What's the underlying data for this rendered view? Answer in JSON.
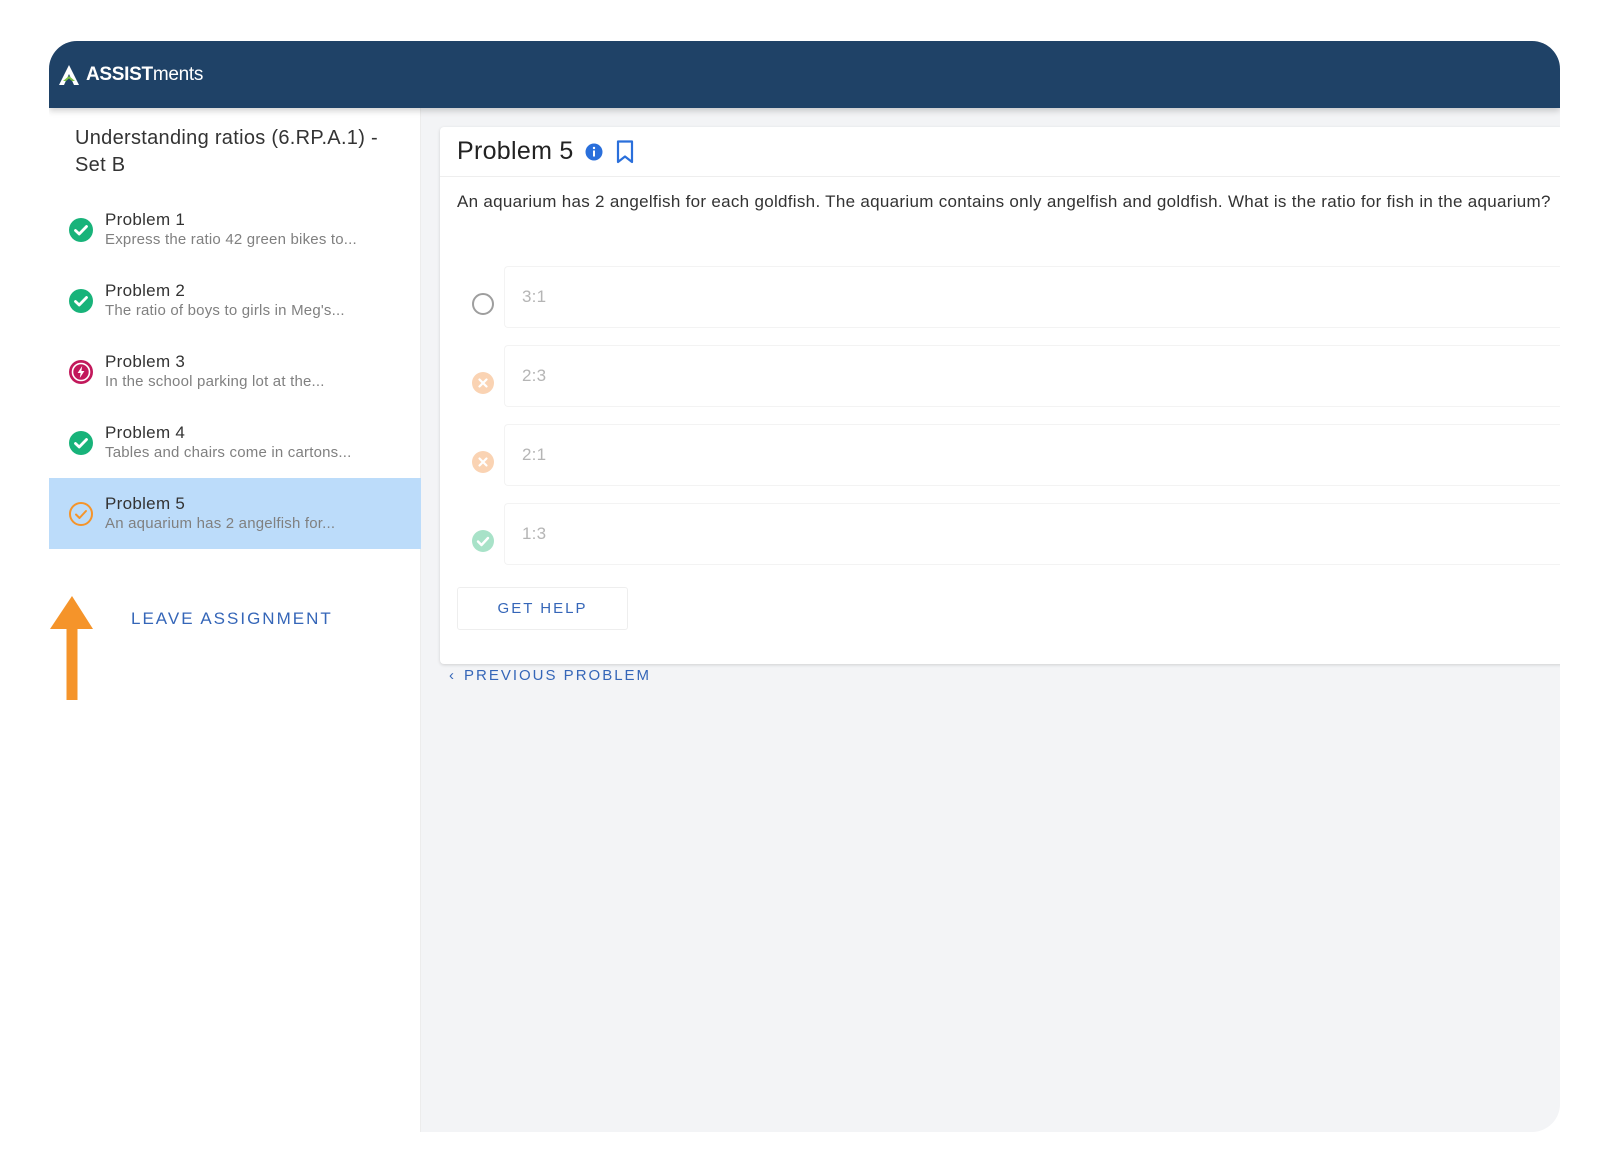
{
  "app": {
    "logo_bold": "ASSIST",
    "logo_light": "ments"
  },
  "assignment": {
    "title": "Understanding ratios (6.RP.A.1) - Set B"
  },
  "problems": [
    {
      "name": "Problem 1",
      "preview": "Express the ratio 42 green bikes to...",
      "status": "correct"
    },
    {
      "name": "Problem 2",
      "preview": "The ratio of boys to girls in Meg's...",
      "status": "correct"
    },
    {
      "name": "Problem 3",
      "preview": "In the school parking lot at the...",
      "status": "flagged"
    },
    {
      "name": "Problem 4",
      "preview": "Tables and chairs come in cartons...",
      "status": "correct"
    },
    {
      "name": "Problem 5",
      "preview": "An aquarium has 2 angelfish for...",
      "status": "partial"
    }
  ],
  "leave_label": "LEAVE ASSIGNMENT",
  "current": {
    "title": "Problem 5",
    "question": "An aquarium has 2 angelfish for each goldfish. The aquarium contains only angelfish and goldfish. What is the ratio for fish in the aquarium?",
    "choices": [
      {
        "label": "3:1",
        "state": "unselected"
      },
      {
        "label": "2:3",
        "state": "incorrect"
      },
      {
        "label": "2:1",
        "state": "incorrect"
      },
      {
        "label": "1:3",
        "state": "correct"
      }
    ],
    "get_help_label": "GET HELP"
  },
  "prev_label": "PREVIOUS PROBLEM",
  "colors": {
    "header": "#1f4267",
    "accent": "#3566b8",
    "correct": "#18b37a",
    "flagged": "#c2185b",
    "partial": "#f5942a",
    "active_row": "#bcdcfa"
  }
}
